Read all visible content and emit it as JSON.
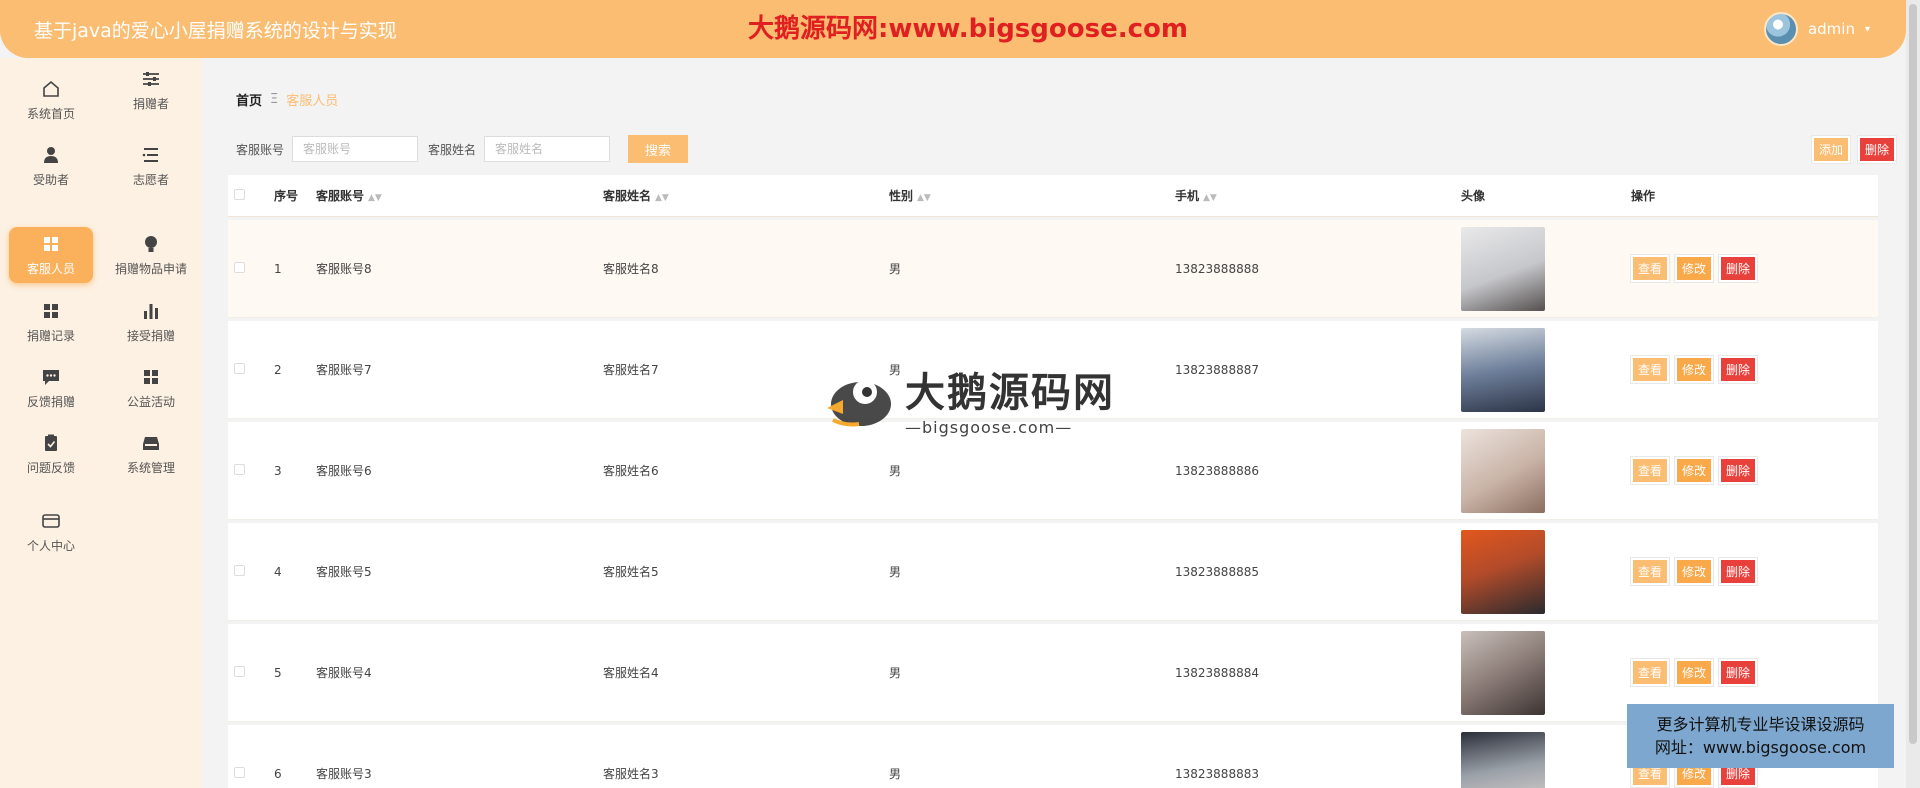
{
  "header": {
    "title": "基于java的爱心小屋捐赠系统的设计与实现",
    "watermark": "大鹅源码网:www.bigsgoose.com",
    "username": "admin",
    "caret": "▾"
  },
  "sidebar": {
    "items": [
      {
        "label": "系统首页",
        "icon": "home-icon"
      },
      {
        "label": "捐赠者",
        "icon": "sliders-icon"
      },
      {
        "label": "受助者",
        "icon": "person-icon"
      },
      {
        "label": "志愿者",
        "icon": "list-icon"
      },
      {
        "label": "客服人员",
        "icon": "grid-icon",
        "active": true
      },
      {
        "label": "捐赠物品申请",
        "icon": "bulb-icon"
      },
      {
        "label": "捐赠记录",
        "icon": "grid-icon"
      },
      {
        "label": "接受捐赠",
        "icon": "bar-chart-icon"
      },
      {
        "label": "反馈捐赠",
        "icon": "chat-icon"
      },
      {
        "label": "公益活动",
        "icon": "grid-icon"
      },
      {
        "label": "问题反馈",
        "icon": "clipboard-icon"
      },
      {
        "label": "系统管理",
        "icon": "tray-icon"
      },
      {
        "label": "个人中心",
        "icon": "card-icon"
      }
    ]
  },
  "breadcrumb": {
    "home": "首页",
    "sep": "Ξ",
    "current": "客服人员"
  },
  "search": {
    "account_label": "客服账号",
    "account_placeholder": "客服账号",
    "name_label": "客服姓名",
    "name_placeholder": "客服姓名",
    "button": "搜索"
  },
  "actions": {
    "add": "添加",
    "delete": "删除"
  },
  "table": {
    "headers": {
      "index": "序号",
      "account": "客服账号",
      "name": "客服姓名",
      "sex": "性别",
      "phone": "手机",
      "photo": "头像",
      "ops": "操作"
    },
    "ops": {
      "view": "查看",
      "edit": "修改",
      "delete": "删除"
    },
    "rows": [
      {
        "index": "1",
        "account": "客服账号8",
        "name": "客服姓名8",
        "sex": "男",
        "phone": "13823888888"
      },
      {
        "index": "2",
        "account": "客服账号7",
        "name": "客服姓名7",
        "sex": "男",
        "phone": "13823888887"
      },
      {
        "index": "3",
        "account": "客服账号6",
        "name": "客服姓名6",
        "sex": "男",
        "phone": "13823888886"
      },
      {
        "index": "4",
        "account": "客服账号5",
        "name": "客服姓名5",
        "sex": "男",
        "phone": "13823888885"
      },
      {
        "index": "5",
        "account": "客服账号4",
        "name": "客服姓名4",
        "sex": "男",
        "phone": "13823888884"
      },
      {
        "index": "6",
        "account": "客服账号3",
        "name": "客服姓名3",
        "sex": "男",
        "phone": "13823888883"
      }
    ]
  },
  "logo": {
    "big": "大鹅源码网",
    "small": "—bigsgoose.com—"
  },
  "promo": {
    "line1": "更多计算机专业毕设课设源码",
    "line2": "网址：www.bigsgoose.com"
  },
  "colors": {
    "accent": "#fbbd72",
    "danger": "#e8413c",
    "sidebar_bg": "#fdf1e3"
  }
}
